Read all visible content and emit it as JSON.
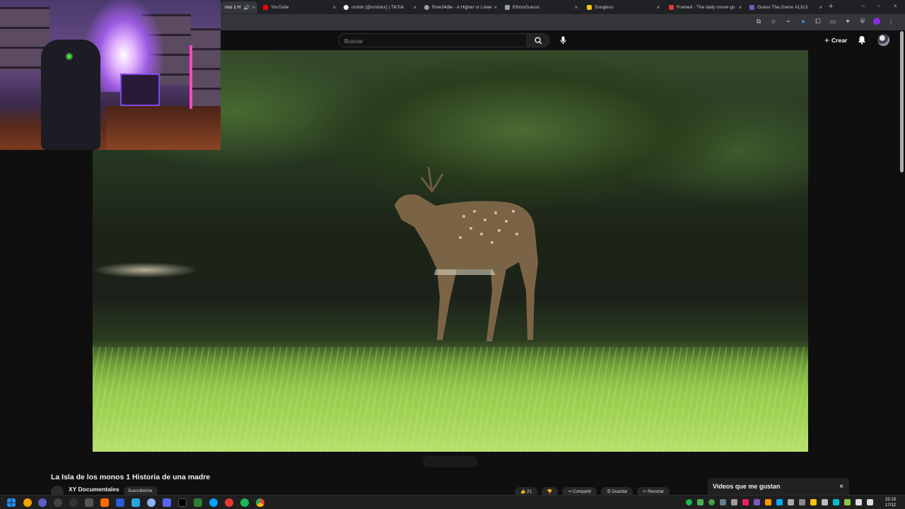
{
  "browser": {
    "tabs": [
      {
        "label": "nos 1 H",
        "active": true,
        "color": "#ff0000"
      },
      {
        "label": "YouTube",
        "active": false,
        "color": "#ff0000"
      },
      {
        "label": "orslok (@orslokx) | TikTok",
        "active": false,
        "color": "#ffffff"
      },
      {
        "label": "Rule34dle - A Higher or Lowe",
        "active": false,
        "color": "#9aa0a6"
      },
      {
        "label": "EthnoGuessr",
        "active": false,
        "color": "#9aa0a6"
      },
      {
        "label": "Songless",
        "active": false,
        "color": "#f5c518"
      },
      {
        "label": "Framed - The daily movie gu",
        "active": false,
        "color": "#e53935"
      },
      {
        "label": "Guess The.Game #1313",
        "active": false,
        "color": "#7e57c2"
      }
    ],
    "close_glyph": "×",
    "new_tab_glyph": "+",
    "window_controls": [
      "–",
      "▫",
      "×"
    ]
  },
  "youtube": {
    "search_placeholder": "Buscar",
    "create_label": "Crear",
    "video_title": "La Isla de los monos 1 Historia de una madre",
    "channel_name": "XY Documentales",
    "subscribe_label": "Suscribirme",
    "actions": [
      "21",
      "",
      "Compartir",
      "Guardar",
      "Recortar"
    ],
    "side_panel_title": "Videos que me gustan",
    "side_panel_close": "×"
  },
  "taskbar": {
    "time": "22:13",
    "date": "17/12"
  },
  "icons": {
    "accent": "#ff0000",
    "windows_blue": "#1e90ff"
  }
}
